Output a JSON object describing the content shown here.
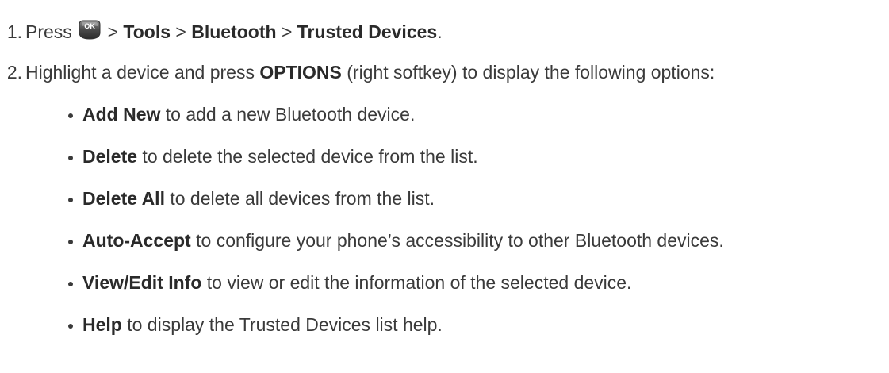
{
  "steps": [
    {
      "number": "1.",
      "prefix": "Press",
      "key_label": "OK",
      "path_sep1": " > ",
      "path1": "Tools",
      "path_sep2": " > ",
      "path2": "Bluetooth",
      "path_sep3": " > ",
      "path3": "Trusted Devices",
      "suffix": "."
    },
    {
      "number": "2.",
      "prefix": "Highlight a device and press ",
      "bold": "OPTIONS",
      "suffix": " (right softkey) to display the following options:"
    }
  ],
  "options": [
    {
      "term": "Add New",
      "desc": " to add a new Bluetooth device."
    },
    {
      "term": "Delete",
      "desc": " to delete the selected device from the list."
    },
    {
      "term": "Delete All",
      "desc": " to delete all devices from the list."
    },
    {
      "term": "Auto-Accept",
      "desc": " to configure your phone’s accessibility to other Bluetooth devices."
    },
    {
      "term": "View/Edit Info",
      "desc": " to view or edit the information of the selected device."
    },
    {
      "term": "Help",
      "desc": " to display the Trusted Devices list help."
    }
  ],
  "colors": {
    "text": "#3a3a3a",
    "key_fill": "#4a4a4a"
  },
  "icons": {
    "ok_key": "ok-key-icon"
  }
}
